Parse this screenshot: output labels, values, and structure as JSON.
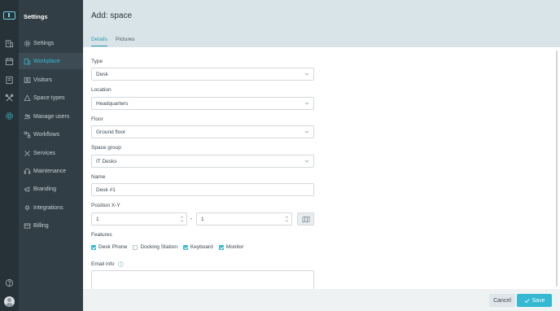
{
  "sidebar": {
    "title": "Settings",
    "items": [
      {
        "label": "Settings",
        "icon": "gear-icon"
      },
      {
        "label": "Workplace",
        "icon": "building-icon",
        "active": true
      },
      {
        "label": "Visitors",
        "icon": "id-card-icon"
      },
      {
        "label": "Space types",
        "icon": "shapes-icon"
      },
      {
        "label": "Manage users",
        "icon": "users-icon"
      },
      {
        "label": "Workflows",
        "icon": "workflow-icon"
      },
      {
        "label": "Services",
        "icon": "tools-icon"
      },
      {
        "label": "Maintenance",
        "icon": "headset-icon"
      },
      {
        "label": "Branding",
        "icon": "megaphone-icon"
      },
      {
        "label": "Integrations",
        "icon": "plug-icon"
      },
      {
        "label": "Billing",
        "icon": "card-icon"
      }
    ]
  },
  "rail": {
    "icons": [
      "building-icon",
      "calendar-icon",
      "book-icon",
      "tools-icon",
      "gear-icon"
    ],
    "active": "gear-icon",
    "bottom": [
      "help-icon",
      "avatar"
    ]
  },
  "header": {
    "title": "Add: space",
    "tabs": [
      {
        "label": "Details",
        "active": true
      },
      {
        "label": "Pictures",
        "active": false
      }
    ]
  },
  "form": {
    "type": {
      "label": "Type",
      "value": "Desk"
    },
    "location": {
      "label": "Location",
      "value": "Headquarters"
    },
    "floor": {
      "label": "Floor",
      "value": "Ground floor"
    },
    "space_group": {
      "label": "Space group",
      "value": "IT Desks"
    },
    "name": {
      "label": "Name",
      "value": "Desk #1"
    },
    "position": {
      "label": "Position X-Y",
      "x": "1",
      "separator": "-",
      "y": "1"
    },
    "features": {
      "label": "Features",
      "options": [
        {
          "label": "Desk Phone",
          "checked": true
        },
        {
          "label": "Docking Station",
          "checked": false
        },
        {
          "label": "Keyboard",
          "checked": true
        },
        {
          "label": "Monitor",
          "checked": true
        }
      ]
    },
    "email_info": {
      "label": "Email info",
      "value": ""
    }
  },
  "footer": {
    "cancel_label": "Cancel",
    "save_label": "Save"
  },
  "colors": {
    "accent": "#35b8d1",
    "rail_bg": "#263238",
    "nav_bg": "#323e45",
    "header_bg": "#d8e4e7"
  }
}
